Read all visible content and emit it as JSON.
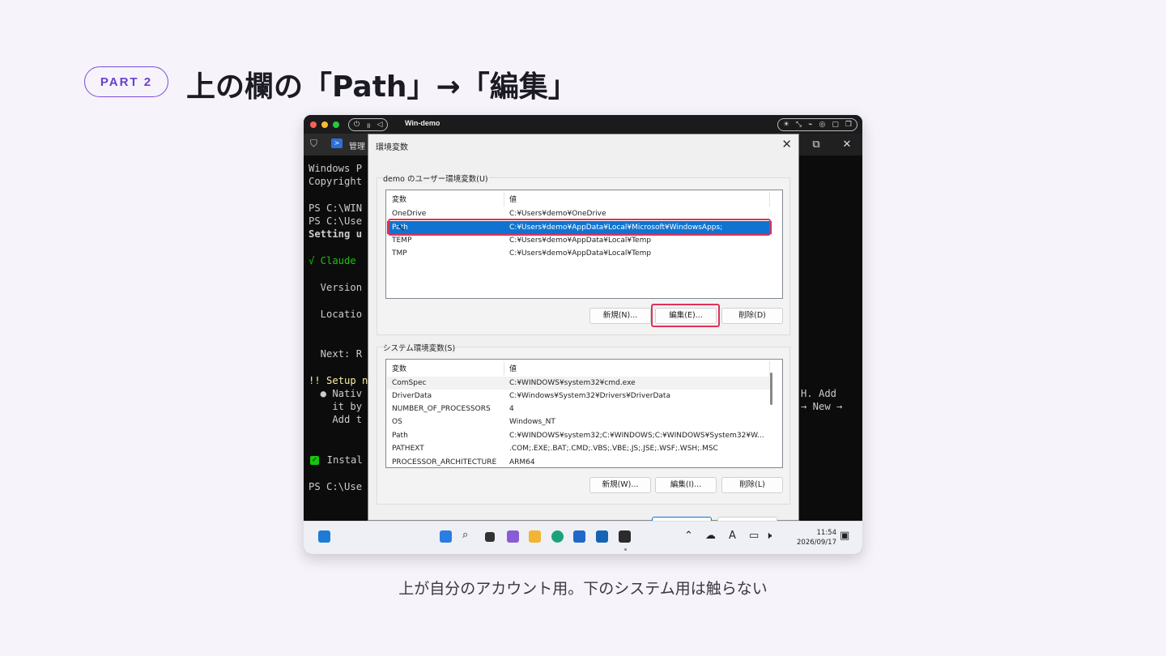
{
  "header": {
    "part_label": "PART 2",
    "title": "上の欄の「Path」→「編集」"
  },
  "caption": "上が自分のアカウント用。下のシステム用は触らない",
  "vm_window": {
    "title": "Win-demo"
  },
  "terminal": {
    "tab_label": "管理",
    "lines_left": [
      {
        "text": "Windows P",
        "color": "#cccccc"
      },
      {
        "text": "Copyright",
        "color": "#cccccc"
      },
      {
        "text": "PS C:\\WIN",
        "color": "#cccccc"
      },
      {
        "text": "PS C:\\Use",
        "color": "#cccccc"
      },
      {
        "text": "Setting u",
        "color": "#cccccc"
      },
      {
        "text": "√ Claude ",
        "color": "#16c60c"
      },
      {
        "text": "  Version",
        "color": "#cccccc"
      },
      {
        "text": "  Locatio",
        "color": "#cccccc"
      },
      {
        "text": "  Next: R",
        "color": "#cccccc"
      },
      {
        "text": "!! Setup n",
        "color": "#f9f1a5"
      },
      {
        "text": "  ● Nativ",
        "color": "#cccccc"
      },
      {
        "text": "    it by",
        "color": "#cccccc"
      },
      {
        "text": "    Add t",
        "color": "#cccccc"
      },
      {
        "text": "  Instal",
        "color": "#cccccc"
      },
      {
        "text": "PS C:\\Use",
        "color": "#cccccc"
      }
    ],
    "lines_right": [
      "H. Add",
      "→ New →"
    ]
  },
  "dialog": {
    "title": "環境変数",
    "user_group_label": "demo のユーザー環境変数(U)",
    "system_group_label": "システム環境変数(S)",
    "col_variable": "変数",
    "col_value": "値",
    "user_vars": [
      {
        "name": "OneDrive",
        "value": "C:¥Users¥demo¥OneDrive"
      },
      {
        "name": "Path",
        "value": "C:¥Users¥demo¥AppData¥Local¥Microsoft¥WindowsApps;"
      },
      {
        "name": "TEMP",
        "value": "C:¥Users¥demo¥AppData¥Local¥Temp"
      },
      {
        "name": "TMP",
        "value": "C:¥Users¥demo¥AppData¥Local¥Temp"
      }
    ],
    "user_buttons": {
      "new": "新規(N)...",
      "edit": "編集(E)...",
      "delete": "削除(D)"
    },
    "system_vars": [
      {
        "name": "ComSpec",
        "value": "C:¥WINDOWS¥system32¥cmd.exe"
      },
      {
        "name": "DriverData",
        "value": "C:¥Windows¥System32¥Drivers¥DriverData"
      },
      {
        "name": "NUMBER_OF_PROCESSORS",
        "value": "4"
      },
      {
        "name": "OS",
        "value": "Windows_NT"
      },
      {
        "name": "Path",
        "value": "C:¥WINDOWS¥system32;C:¥WINDOWS;C:¥WINDOWS¥System32¥W..."
      },
      {
        "name": "PATHEXT",
        "value": ".COM;.EXE;.BAT;.CMD;.VBS;.VBE;.JS;.JSE;.WSF;.WSH;.MSC"
      },
      {
        "name": "PROCESSOR_ARCHITECTURE",
        "value": "ARM64"
      }
    ],
    "system_buttons": {
      "new": "新規(W)...",
      "edit": "編集(I)...",
      "delete": "削除(L)"
    }
  },
  "taskbar": {
    "time": "11:54",
    "date": "2026/09/17"
  },
  "colors": {
    "accent_purple": "#7c4fd8",
    "highlight_red": "#e03258",
    "selection_blue": "#0f74d1"
  }
}
